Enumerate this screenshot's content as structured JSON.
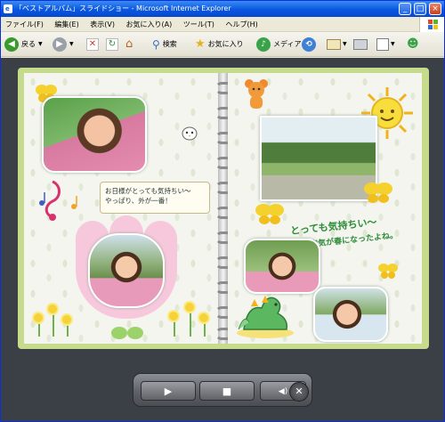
{
  "window": {
    "title": "「ベストアルバム」スライドショー - Microsoft Internet Explorer",
    "app_icon": "e",
    "min_symbol": "_",
    "max_symbol": "□",
    "close_symbol": "×"
  },
  "menu": [
    "ファイル(F)",
    "編集(E)",
    "表示(V)",
    "お気に入り(A)",
    "ツール(T)",
    "ヘルプ(H)"
  ],
  "toolbar": {
    "back_label": "戻る",
    "search_label": "検索",
    "favorites_label": "お気に入り",
    "media_label": "メディア"
  },
  "album": {
    "speech_bubble_line1": "お日様がとっても気持ちい〜",
    "speech_bubble_line2": "やっぱり、外が一番！",
    "caption_line1": "とっても気持ちい〜",
    "caption_line2": "空気が春になったよね。"
  },
  "player": {
    "play_symbol": "▶",
    "stop_symbol": "■",
    "volume_symbol": "◀)",
    "close_symbol": "✕"
  },
  "colors": {
    "titlebar": "#0a57e0",
    "book_border": "#c7db8d",
    "stage": "#3b3f46",
    "caption_green": "#2e8c3a",
    "tulip_pink": "#f7c8dc"
  }
}
